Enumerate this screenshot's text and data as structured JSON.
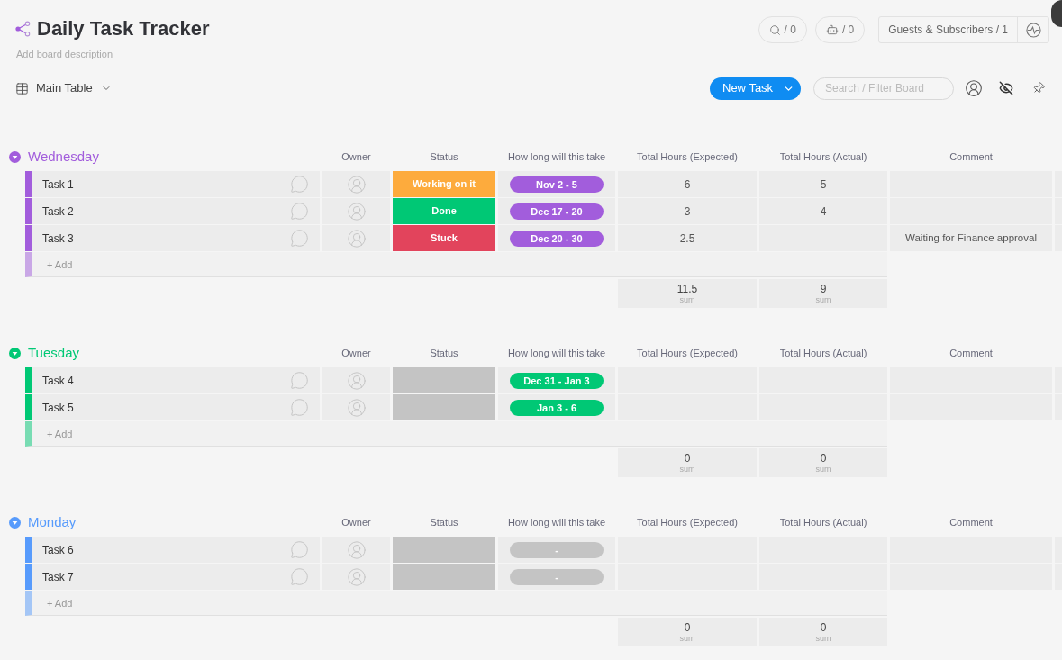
{
  "board": {
    "title": "Daily Task Tracker",
    "description": {
      "placeholder": "Add board description"
    }
  },
  "counters": [
    {
      "kind": "integrations",
      "label": "/ 0"
    },
    {
      "kind": "automations",
      "label": "/ 0"
    }
  ],
  "guests": {
    "label": "Guests & Subscribers / 1"
  },
  "view": {
    "label": "Main Table"
  },
  "new_button": {
    "label": "New Task"
  },
  "search": {
    "placeholder": "Search / Filter Board"
  },
  "groups": [
    {
      "name": "Wednesday",
      "color": "#a25ddc",
      "expanded": true,
      "columns": [
        "Owner",
        "Status",
        "How long will this take",
        "Total Hours (Expected)",
        "Total Hours (Actual)",
        "Comment"
      ],
      "rows": [
        {
          "name": "Task 1",
          "status": {
            "label": "Working on it",
            "color": "#fdab3d"
          },
          "timeline": {
            "label": "Nov 2 - 5",
            "filled": true
          },
          "expected": "6",
          "actual": "5"
        },
        {
          "name": "Task 2",
          "status": {
            "label": "Done",
            "color": "#00c875"
          },
          "timeline": {
            "label": "Dec 17 - 20",
            "filled": true
          },
          "expected": "3",
          "actual": "4"
        },
        {
          "name": "Task 3",
          "status": {
            "label": "Stuck",
            "color": "#e2445c"
          },
          "timeline": {
            "label": "Dec 20 - 30",
            "filled": true
          },
          "expected": "2.5",
          "comment": "Waiting for Finance approval"
        }
      ],
      "add": {
        "placeholder": "+ Add"
      },
      "sums": [
        {
          "value": "11.5",
          "label": "sum"
        },
        {
          "value": "9",
          "label": "sum"
        }
      ]
    },
    {
      "name": "Tuesday",
      "color": "#00c875",
      "expanded": true,
      "columns": [
        "Owner",
        "Status",
        "How long will this take",
        "Total Hours (Expected)",
        "Total Hours (Actual)",
        "Comment"
      ],
      "rows": [
        {
          "name": "Task 4",
          "status": {
            "color": "#c4c4c4"
          },
          "timeline": {
            "label": "Dec 31 - Jan 3",
            "filled": true
          }
        },
        {
          "name": "Task 5",
          "status": {
            "color": "#c4c4c4"
          },
          "timeline": {
            "label": "Jan 3 - 6",
            "filled": true
          }
        }
      ],
      "add": {
        "placeholder": "+ Add"
      },
      "sums": [
        {
          "value": "0",
          "label": "sum"
        },
        {
          "value": "0",
          "label": "sum"
        }
      ]
    },
    {
      "name": "Monday",
      "color": "#579bfc",
      "expanded": true,
      "columns": [
        "Owner",
        "Status",
        "How long will this take",
        "Total Hours (Expected)",
        "Total Hours (Actual)",
        "Comment"
      ],
      "rows": [
        {
          "name": "Task 6",
          "status": {
            "color": "#c4c4c4"
          },
          "timeline": {
            "label": "-",
            "filled": false
          }
        },
        {
          "name": "Task 7",
          "status": {
            "color": "#c4c4c4"
          },
          "timeline": {
            "label": "-",
            "filled": false
          }
        }
      ],
      "add": {
        "placeholder": "+ Add"
      },
      "sums": [
        {
          "value": "0",
          "label": "sum"
        },
        {
          "value": "0",
          "label": "sum"
        }
      ]
    }
  ]
}
